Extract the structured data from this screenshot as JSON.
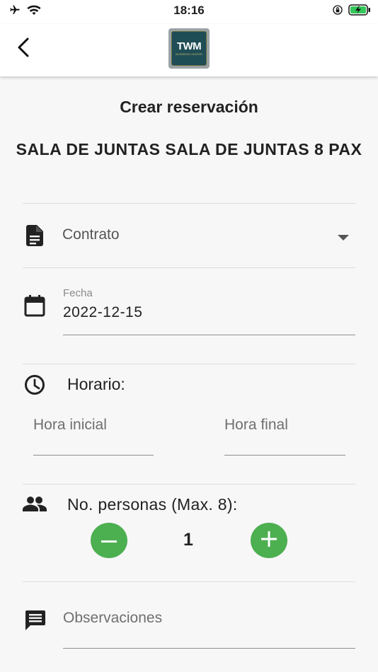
{
  "status_bar": {
    "time": "18:16",
    "left_icons": [
      "airplane-icon",
      "wifi-icon"
    ],
    "right_icons": [
      "orientation-lock-icon",
      "battery-charging-icon"
    ],
    "battery_color": "#34c759"
  },
  "app_bar": {
    "back_icon": "chevron-left-icon",
    "logo_text": "TWM",
    "logo_subtext": "BUSINESS CENTER"
  },
  "page": {
    "title": "Crear reservación",
    "room_name": "SALA DE JUNTAS SALA DE JUNTAS  8 PAX"
  },
  "form": {
    "contrato": {
      "icon": "document-icon",
      "label": "Contrato",
      "arrow_icon": "dropdown-arrow-icon"
    },
    "fecha": {
      "icon": "calendar-icon",
      "label": "Fecha",
      "value": "2022-12-15"
    },
    "horario": {
      "icon": "clock-icon",
      "label": "Horario:",
      "start_placeholder": "Hora inicial",
      "end_placeholder": "Hora final"
    },
    "personas": {
      "icon": "people-icon",
      "label": "No. personas (Max. 8):",
      "count": "1",
      "button_color": "#4caf50",
      "minus_icon": "minus-icon",
      "plus_icon": "plus-icon"
    },
    "observaciones": {
      "icon": "comment-icon",
      "placeholder": "Observaciones"
    }
  }
}
